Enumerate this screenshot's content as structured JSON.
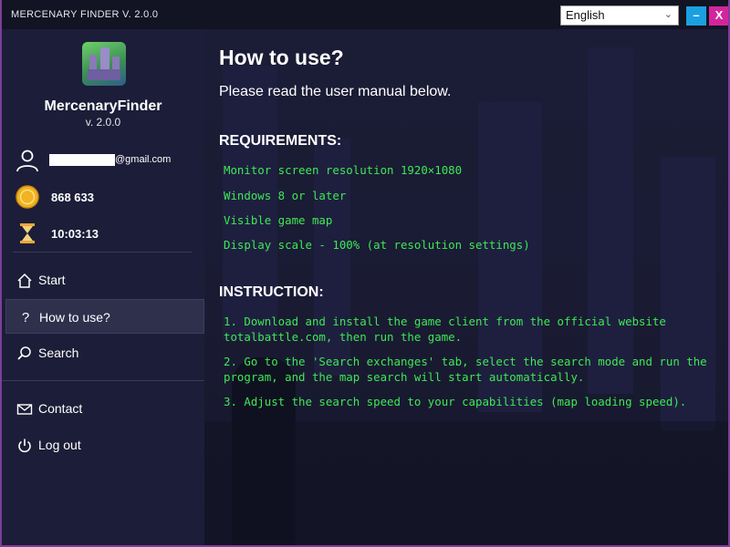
{
  "window": {
    "title": "MERCENARY FINDER V. 2.0.0"
  },
  "language": {
    "selected": "English",
    "arrow": "⌄"
  },
  "controls": {
    "minimize": "–",
    "close": "X"
  },
  "sidebar": {
    "app_name": "MercenaryFinder",
    "version": "v. 2.0.0",
    "email_suffix": "@gmail.com",
    "balance": "868 633",
    "timer": "10:03:13",
    "nav": [
      {
        "label": "Start",
        "icon": "home-icon"
      },
      {
        "label": "How to use?",
        "icon": "question-icon"
      },
      {
        "label": "Search",
        "icon": "search-icon"
      },
      {
        "label": "Contact",
        "icon": "mail-icon"
      },
      {
        "label": "Log out",
        "icon": "power-icon"
      }
    ],
    "active_index": 1
  },
  "main": {
    "title": "How to use?",
    "subtitle": "Please read the user manual below.",
    "requirements_heading": "REQUIREMENTS:",
    "requirements": [
      "Monitor screen resolution 1920×1080",
      "Windows 8 or later",
      "Visible game map",
      "Display scale - 100% (at resolution settings)"
    ],
    "instruction_heading": "INSTRUCTION:",
    "instructions": [
      "1. Download and install the game client from the official website totalbattle.com, then run the game.",
      "2. Go to the 'Search exchanges' tab, select the search mode and run the program, and the map search will start automatically.",
      "3. Adjust the search speed to your capabilities (map loading speed)."
    ]
  },
  "colors": {
    "accent_green": "#3ee855",
    "minimize_blue": "#1aa0e0",
    "close_magenta": "#d2259c",
    "window_border": "#7b3f9a"
  }
}
